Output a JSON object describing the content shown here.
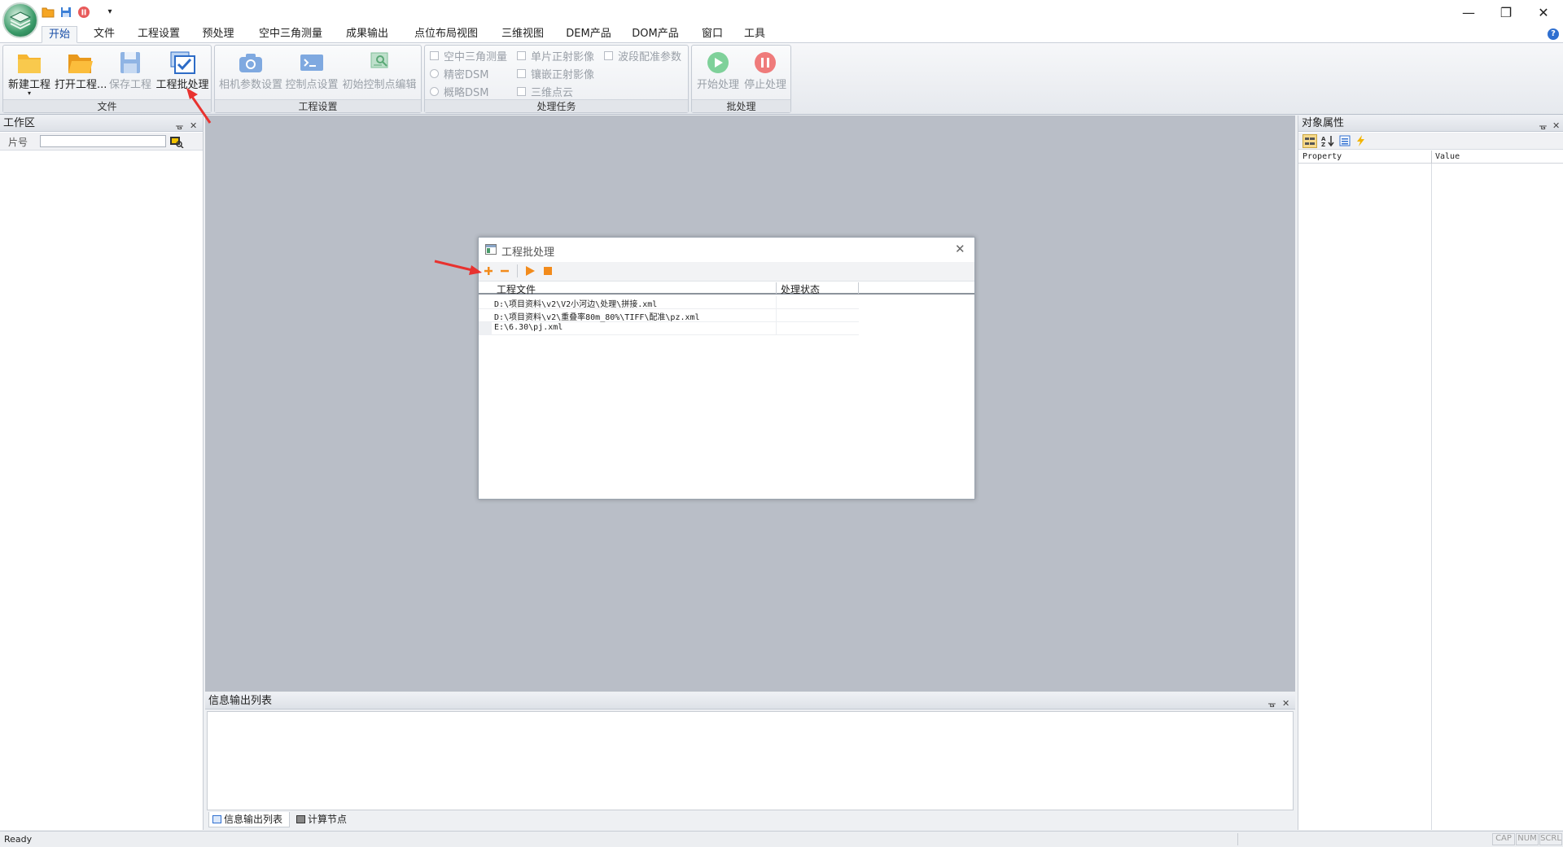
{
  "app": {
    "window_controls": {
      "minimize": "—",
      "restore": "❐",
      "close": "✕"
    }
  },
  "quick_access": [
    {
      "icon": "open-folder-icon"
    },
    {
      "icon": "save-icon"
    },
    {
      "icon": "stop-icon"
    },
    {
      "icon": "customize-dropdown-icon",
      "label": "▾"
    }
  ],
  "menu": [
    {
      "label": "开始",
      "active": true
    },
    {
      "label": "文件"
    },
    {
      "label": "工程设置"
    },
    {
      "label": "预处理"
    },
    {
      "label": "空中三角测量"
    },
    {
      "label": "成果输出"
    },
    {
      "label": "点位布局视图"
    },
    {
      "label": "三维视图"
    },
    {
      "label": "DEM产品"
    },
    {
      "label": "DOM产品"
    },
    {
      "label": "窗口"
    },
    {
      "label": "工具"
    }
  ],
  "ribbon": {
    "file_group": {
      "title": "文件",
      "new_project": "新建工程",
      "open_project": "打开工程...",
      "save_project": "保存工程",
      "batch_process": "工程批处理"
    },
    "settings_group": {
      "title": "工程设置",
      "camera_params": "相机参数设置",
      "control_points": "控制点设置",
      "initial_control_edit": "初始控制点编辑"
    },
    "tasks_group": {
      "title": "处理任务",
      "aerial_triangulation": "空中三角测量",
      "dense_dsm": "精密DSM",
      "coarse_dsm": "概略DSM",
      "single_ortho": "单片正射影像",
      "mosaic_ortho": "镶嵌正射影像",
      "point_cloud": "三维点云",
      "band_registration": "波段配准参数"
    },
    "batch_group": {
      "title": "批处理",
      "start": "开始处理",
      "stop": "停止处理"
    }
  },
  "workspace": {
    "title": "工作区",
    "pin": "ᚗ",
    "close": "✕",
    "search_label": "片号",
    "search_value": ""
  },
  "properties": {
    "title": "对象属性",
    "pin": "ᚗ",
    "close": "✕",
    "col_property": "Property",
    "col_value": "Value"
  },
  "output": {
    "title": "信息输出列表",
    "pin": "ᚗ",
    "close": "✕",
    "tabs": [
      {
        "label": "信息输出列表"
      },
      {
        "label": "计算节点"
      }
    ]
  },
  "status": {
    "text": "Ready",
    "indicators": [
      "CAP",
      "NUM",
      "SCRL"
    ]
  },
  "dialog": {
    "title": "工程批处理",
    "close": "✕",
    "columns": [
      "工程文件",
      "处理状态"
    ],
    "rows": [
      {
        "file": "D:\\项目资料\\v2\\V2小河边\\处理\\拼接.xml",
        "status": ""
      },
      {
        "file": "D:\\项目资料\\v2\\重叠率80m_80%\\TIFF\\配准\\pz.xml",
        "status": ""
      },
      {
        "file": "E:\\6.30\\pj.xml",
        "status": ""
      }
    ],
    "toolbar": [
      {
        "icon": "add-icon"
      },
      {
        "icon": "remove-icon"
      },
      {
        "icon": "play-icon"
      },
      {
        "icon": "stop-icon"
      }
    ]
  },
  "colors": {
    "annotation_arrow": "#e8322f",
    "accent_orange": "#f28b1c",
    "workspace_bg": "#b9bec7"
  }
}
